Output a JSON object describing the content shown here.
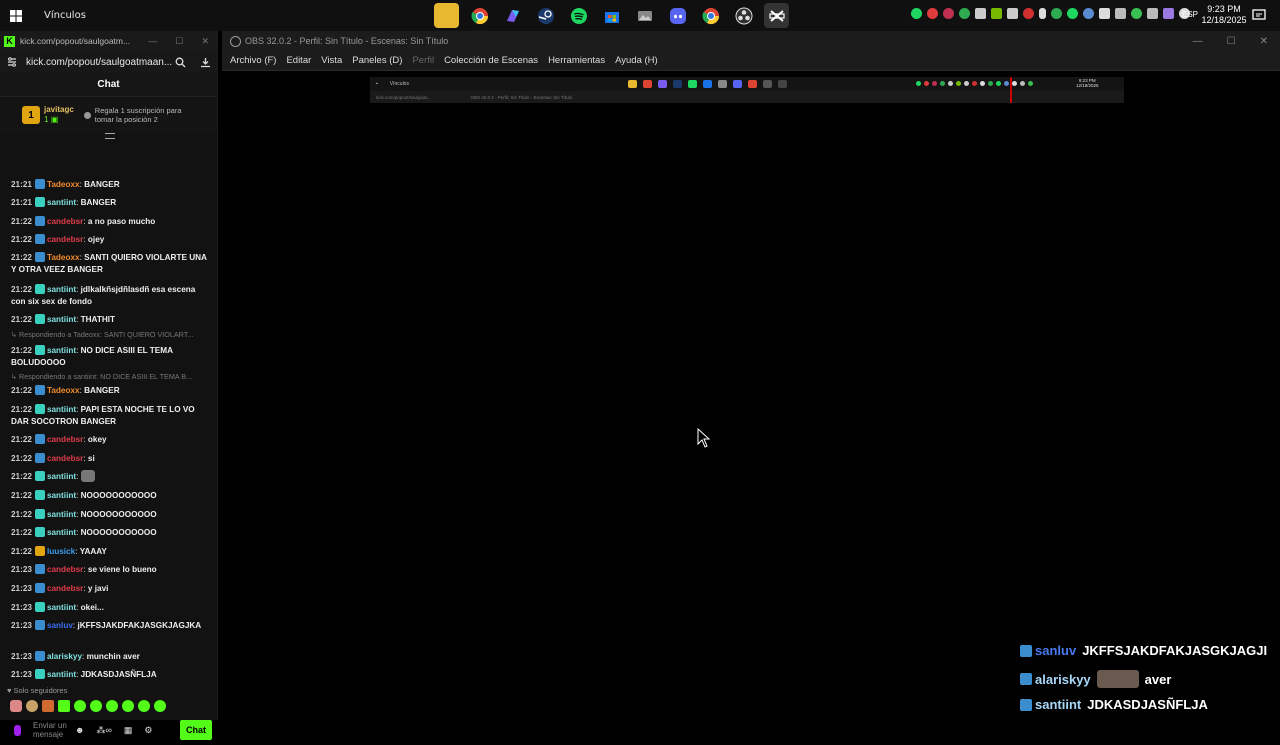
{
  "colors": {
    "kick_green": "#53fc18",
    "taskbar": "#101010",
    "panel": "#121212",
    "obs_bar": "#1c1c1c"
  },
  "taskbar": {
    "label": "Vínculos",
    "apps": [
      "folder-icon",
      "chrome-icon",
      "copilot-icon",
      "steam-icon",
      "spotify-icon",
      "store-icon",
      "photos-icon",
      "discord-icon",
      "chrome-profile-icon",
      "obs-icon",
      "capcut-icon"
    ],
    "lang": "ESP",
    "time": "9:23 PM",
    "date": "12/18/2025"
  },
  "kick": {
    "window_title": "kick.com/popout/saulgoatm...",
    "url": "kick.com/popout/saulgoatmaan...",
    "chat_title": "Chat",
    "pinned": {
      "rank": "1",
      "user": "javitagc",
      "count": "1",
      "message": "Regala 1 suscripción para tomar la posición 2"
    },
    "messages": [
      {
        "time": "21:21",
        "user": "Tadeoxx",
        "color": "#f08a2c",
        "badge": "#3a8ed0",
        "text": "BANGER"
      },
      {
        "time": "21:21",
        "user": "santiint",
        "color": "#7fe0e0",
        "badge": "#3ad0c0",
        "text": "BANGER"
      },
      {
        "time": "21:22",
        "user": "candebsr",
        "color": "#e03c4c",
        "badge": "#3a8ed0",
        "text": "a no paso mucho"
      },
      {
        "time": "21:22",
        "user": "candebsr",
        "color": "#e03c4c",
        "badge": "#3a8ed0",
        "text": "ojey"
      },
      {
        "time": "21:22",
        "user": "Tadeoxx",
        "color": "#f08a2c",
        "badge": "#3a8ed0",
        "text": "SANTI QUIERO VIOLARTE UNA Y OTRA VEEZ BANGER"
      },
      {
        "time": "21:22",
        "user": "santiint",
        "color": "#7fe0e0",
        "badge": "#3ad0c0",
        "text": "jdlkalkñsjdñlasdñ esa escena con six sex de fondo"
      },
      {
        "time": "21:22",
        "user": "santiint",
        "color": "#7fe0e0",
        "badge": "#3ad0c0",
        "text": "THATHIT"
      },
      {
        "time": "21:22",
        "user": "santiint",
        "color": "#7fe0e0",
        "badge": "#3ad0c0",
        "text": "NO DICE ASIII EL TEMA BOLUDOOOO",
        "reply": "Respondiendo a Tadeoxx: SANTI QUIERO VIOLART..."
      },
      {
        "time": "21:22",
        "user": "Tadeoxx",
        "color": "#f08a2c",
        "badge": "#3a8ed0",
        "text": "BANGER",
        "reply": "Respondiendo a santiint: NO DICE ASIII EL TEMA B..."
      },
      {
        "time": "21:22",
        "user": "santiint",
        "color": "#7fe0e0",
        "badge": "#3ad0c0",
        "text": "PAPI ESTA NOCHE TE LO VO DAR SOCOTRON BANGER"
      },
      {
        "time": "21:22",
        "user": "candebsr",
        "color": "#e03c4c",
        "badge": "#3a8ed0",
        "text": "okey"
      },
      {
        "time": "21:22",
        "user": "candebsr",
        "color": "#e03c4c",
        "badge": "#3a8ed0",
        "text": "si"
      },
      {
        "time": "21:22",
        "user": "santiint",
        "color": "#7fe0e0",
        "badge": "#3ad0c0",
        "text": "",
        "emote": true
      },
      {
        "time": "21:22",
        "user": "santiint",
        "color": "#7fe0e0",
        "badge": "#3ad0c0",
        "text": "NOOOOOOOOOOO"
      },
      {
        "time": "21:22",
        "user": "santiint",
        "color": "#7fe0e0",
        "badge": "#3ad0c0",
        "text": "NOOOOOOOOOOO"
      },
      {
        "time": "21:22",
        "user": "santiint",
        "color": "#7fe0e0",
        "badge": "#3ad0c0",
        "text": "NOOOOOOOOOOO"
      },
      {
        "time": "21:22",
        "user": "luusick",
        "color": "#3a9ef0",
        "badge": "#e0a511",
        "text": "YAAAY"
      },
      {
        "time": "21:23",
        "user": "candebsr",
        "color": "#e03c4c",
        "badge": "#3a8ed0",
        "text": "se viene lo bueno"
      },
      {
        "time": "21:23",
        "user": "candebsr",
        "color": "#e03c4c",
        "badge": "#3a8ed0",
        "text": "y javi"
      },
      {
        "time": "21:23",
        "user": "santiint",
        "color": "#7fe0e0",
        "badge": "#3ad0c0",
        "text": "okei..."
      },
      {
        "time": "21:23",
        "user": "sanluv",
        "color": "#3a6ef0",
        "badge": "#3a8ed0",
        "text": "jKFFSJAKDFAKJASGKJAGJKA"
      },
      {
        "time": "21:23",
        "user": "alariskyy",
        "color": "#7fe0e0",
        "badge": "#3a8ed0",
        "text": "munchin aver"
      },
      {
        "time": "21:23",
        "user": "santiint",
        "color": "#7fe0e0",
        "badge": "#3ad0c0",
        "text": "JDKASDJASÑFLJA"
      }
    ],
    "followers_only": "Solo seguidores",
    "input_placeholder": "Enviar un mensaje",
    "chat_button": "Chat"
  },
  "obs": {
    "title": "OBS 32.0.2 - Perfil: Sin Título - Escenas: Sin Título",
    "menu": [
      {
        "label": "Archivo (F)",
        "disabled": false
      },
      {
        "label": "Editar",
        "disabled": false
      },
      {
        "label": "Vista",
        "disabled": false
      },
      {
        "label": "Paneles (D)",
        "disabled": false
      },
      {
        "label": "Perfil",
        "disabled": true
      },
      {
        "label": "Colección de Escenas",
        "disabled": false
      },
      {
        "label": "Herramientas",
        "disabled": false
      },
      {
        "label": "Ayuda (H)",
        "disabled": false
      }
    ],
    "preview": {
      "taskbar_label": "Vínculos",
      "time": "9:23 PM",
      "date": "12/18/2025",
      "tab1": "kick.com/popout/saulgoat...",
      "tab2": "OBS 32.0.2 - Perfil: Sin Título - Escenas: Sin Título"
    }
  },
  "overlay": [
    {
      "user": "sanluv",
      "color": "#4a7af0",
      "text": "JKFFSJAKDFAKJASGKJAGJI"
    },
    {
      "user": "alariskyy",
      "color": "#a8d8f8",
      "text": "aver",
      "emote": true
    },
    {
      "user": "santiint",
      "color": "#a8d8f8",
      "text": "JDKASDJASÑFLJA"
    }
  ]
}
